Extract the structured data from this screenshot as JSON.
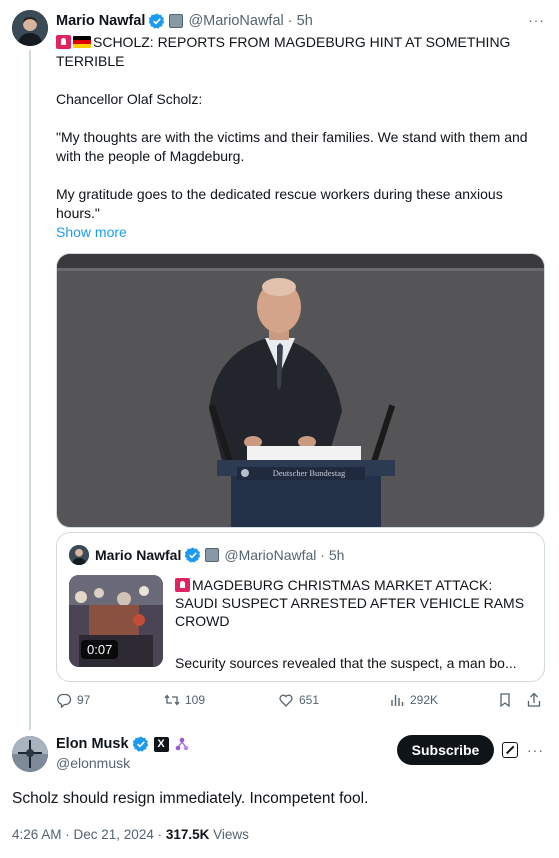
{
  "post": {
    "author_name": "Mario Nawfal",
    "author_handle": "@MarioNawfal",
    "time": "5h",
    "headline": "SCHOLZ: REPORTS FROM MAGDEBURG HINT AT SOMETHING TERRIBLE",
    "paragraph1": "Chancellor Olaf Scholz:",
    "paragraph2": "\"My thoughts are with the victims and their families. We stand with them and with the people of Magdeburg.",
    "paragraph3": "My gratitude goes to the dedicated rescue workers during these anxious hours.\"",
    "show_more": "Show more",
    "media_label": "Deutscher Bundestag"
  },
  "quote": {
    "author_name": "Mario Nawfal",
    "author_handle": "@MarioNawfal",
    "time": "5h",
    "title": "MAGDEBURG CHRISTMAS MARKET ATTACK: SAUDI SUSPECT ARRESTED AFTER VEHICLE RAMS CROWD",
    "snippet": "Security sources revealed that the suspect, a man bo...",
    "video_duration": "0:07"
  },
  "actions": {
    "replies": "97",
    "reposts": "109",
    "likes": "651",
    "views": "292K"
  },
  "reply": {
    "author_name": "Elon Musk",
    "author_handle": "@elonmusk",
    "subscribe_label": "Subscribe",
    "text": "Scholz should resign immediately. Incompetent fool.",
    "timestamp": "4:26 AM · Dec 21, 2024 · ",
    "views_count": "317.5K",
    "views_label": " Views"
  },
  "colors": {
    "accent": "#1d9bf0",
    "text": "#0f1419",
    "muted": "#536471",
    "border": "#cfd9de"
  },
  "icons": [
    "verified-badge-icon",
    "organization-badge-icon",
    "more-icon",
    "reply-icon",
    "repost-icon",
    "like-icon",
    "views-icon",
    "bookmark-icon",
    "share-icon",
    "x-badge-icon",
    "grok-icon"
  ]
}
